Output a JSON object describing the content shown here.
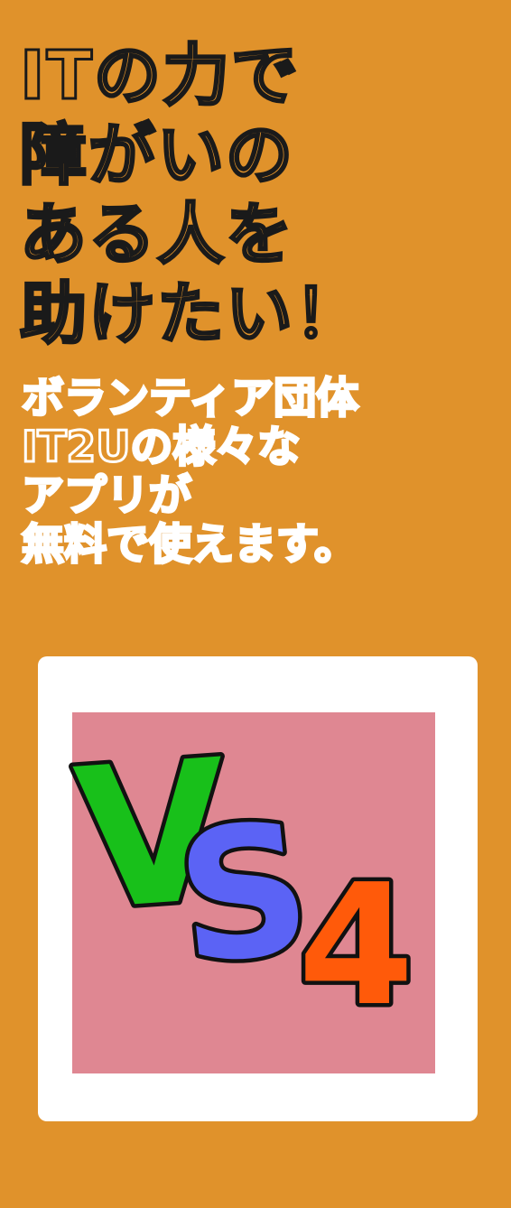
{
  "headline": [
    "ITの力で",
    "障がいの",
    "ある人を",
    "助けたい！"
  ],
  "subtext": [
    "ボランティア団体",
    "IT2Uの様々な",
    "アプリが",
    "無料で使えます。"
  ],
  "logo": {
    "letters": {
      "v": "V",
      "s": "S",
      "four": "4"
    },
    "colors": {
      "background": "#e0922b",
      "frame": "#ffffff",
      "tile": "#df8792",
      "v": "#18c01a",
      "s": "#5b63f5",
      "four": "#ff5a0a",
      "outline": "#111111"
    }
  }
}
